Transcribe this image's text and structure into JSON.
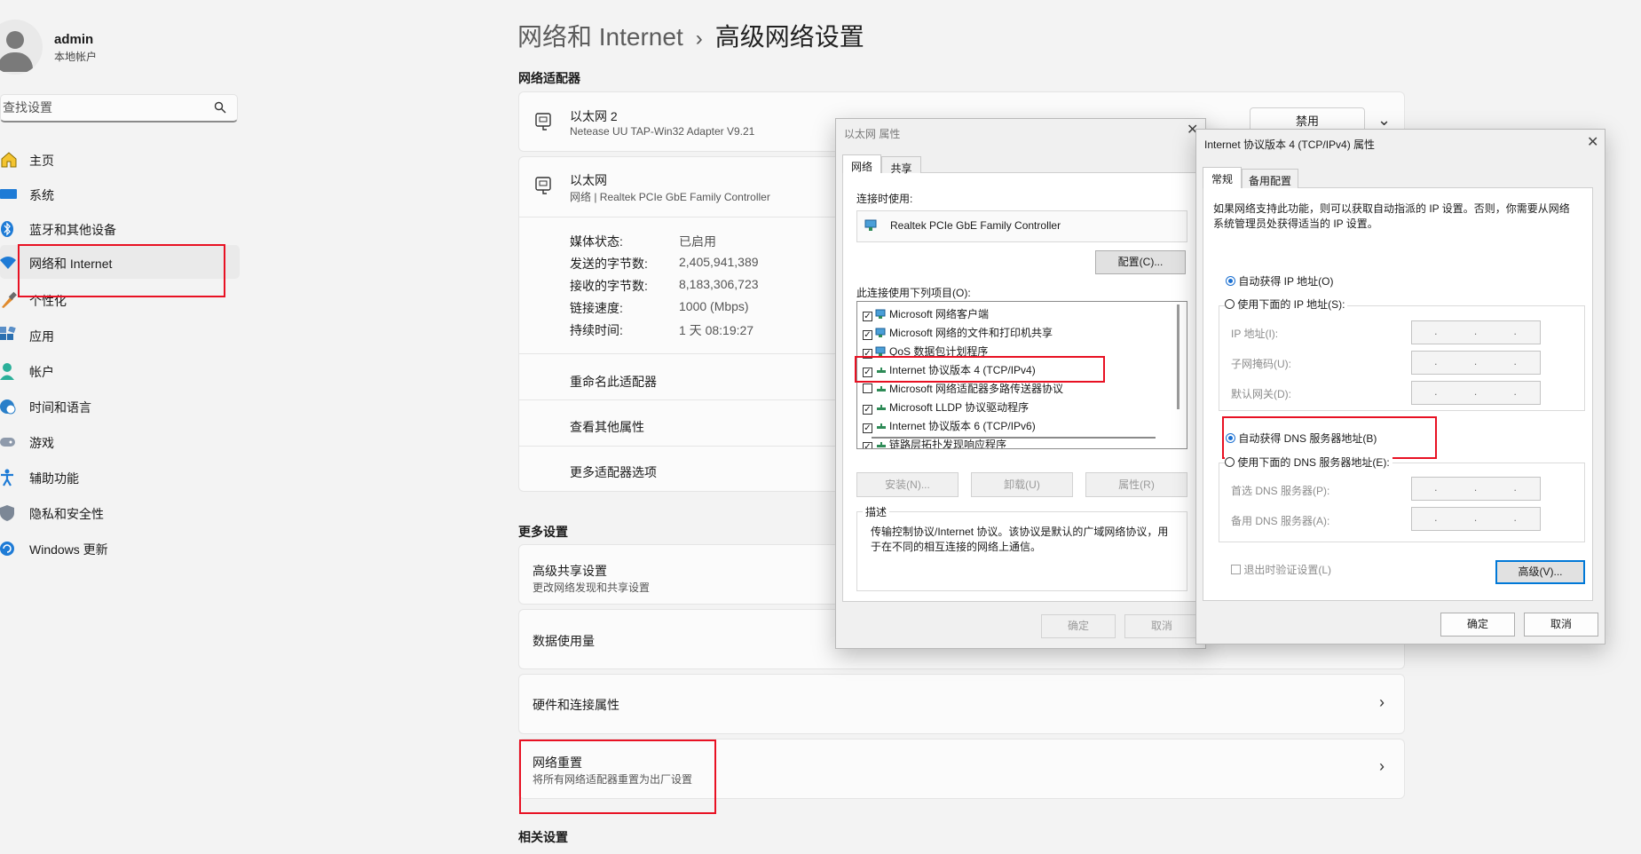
{
  "sidebar": {
    "user_name": "admin",
    "user_type": "本地帐户",
    "search_placeholder": "查找设置",
    "items": [
      {
        "label": "主页",
        "icon": "home-icon"
      },
      {
        "label": "系统",
        "icon": "system-icon"
      },
      {
        "label": "蓝牙和其他设备",
        "icon": "bluetooth-icon"
      },
      {
        "label": "网络和 Internet",
        "icon": "wifi-icon",
        "active": true
      },
      {
        "label": "个性化",
        "icon": "brush-icon"
      },
      {
        "label": "应用",
        "icon": "apps-icon"
      },
      {
        "label": "帐户",
        "icon": "account-icon"
      },
      {
        "label": "时间和语言",
        "icon": "globe-clock-icon"
      },
      {
        "label": "游戏",
        "icon": "gamepad-icon"
      },
      {
        "label": "辅助功能",
        "icon": "accessibility-icon"
      },
      {
        "label": "隐私和安全性",
        "icon": "shield-icon"
      },
      {
        "label": "Windows 更新",
        "icon": "update-icon"
      }
    ]
  },
  "header": {
    "parent": "网络和 Internet",
    "current": "高级网络设置"
  },
  "adapters": {
    "section_label": "网络适配器",
    "adapter1": {
      "name": "以太网 2",
      "desc": "Netease UU TAP-Win32 Adapter V9.21",
      "button": "禁用"
    },
    "adapter2": {
      "name": "以太网",
      "desc": "网络 | Realtek PCIe GbE Family Controller",
      "details": [
        {
          "key": "媒体状态:",
          "value": "已启用"
        },
        {
          "key": "发送的字节数:",
          "value": "2,405,941,389"
        },
        {
          "key": "接收的字节数:",
          "value": "8,183,306,723"
        },
        {
          "key": "链接速度:",
          "value": "1000 (Mbps)"
        },
        {
          "key": "持续时间:",
          "value": "1 天 08:19:27"
        }
      ],
      "actions": [
        "重命名此适配器",
        "查看其他属性",
        "更多适配器选项"
      ]
    }
  },
  "more": {
    "section_label": "更多设置",
    "items": [
      {
        "title": "高级共享设置",
        "sub": "更改网络发现和共享设置"
      },
      {
        "title": "数据使用量",
        "sub": ""
      },
      {
        "title": "硬件和连接属性",
        "sub": ""
      },
      {
        "title": "网络重置",
        "sub": "将所有网络适配器重置为出厂设置"
      }
    ],
    "related_label": "相关设置"
  },
  "ethernet_dialog": {
    "title": "以太网 属性",
    "tabs": [
      "网络",
      "共享"
    ],
    "connect_using_label": "连接时使用:",
    "adapter_name": "Realtek PCIe GbE Family Controller",
    "configure_button": "配置(C)...",
    "items_label": "此连接使用下列项目(O):",
    "items": [
      {
        "label": "Microsoft 网络客户端",
        "checked": true
      },
      {
        "label": "Microsoft 网络的文件和打印机共享",
        "checked": true
      },
      {
        "label": "QoS 数据包计划程序",
        "checked": true
      },
      {
        "label": "Internet 协议版本 4 (TCP/IPv4)",
        "checked": true
      },
      {
        "label": "Microsoft 网络适配器多路传送器协议",
        "checked": false
      },
      {
        "label": "Microsoft LLDP 协议驱动程序",
        "checked": true
      },
      {
        "label": "Internet 协议版本 6 (TCP/IPv6)",
        "checked": true
      },
      {
        "label": "链路层拓扑发现响应程序",
        "checked": true
      }
    ],
    "install_button": "安装(N)...",
    "uninstall_button": "卸载(U)",
    "properties_button": "属性(R)",
    "desc_label": "描述",
    "desc_text": "传输控制协议/Internet 协议。该协议是默认的广域网络协议，用于在不同的相互连接的网络上通信。",
    "ok_button": "确定",
    "cancel_button": "取消"
  },
  "ipv4_dialog": {
    "title": "Internet 协议版本 4 (TCP/IPv4) 属性",
    "tabs": [
      "常规",
      "备用配置"
    ],
    "intro": "如果网络支持此功能，则可以获取自动指派的 IP 设置。否则，你需要从网络系统管理员处获得适当的 IP 设置。",
    "auto_ip": "自动获得 IP 地址(O)",
    "manual_ip": "使用下面的 IP 地址(S):",
    "ip_label": "IP 地址(I):",
    "mask_label": "子网掩码(U):",
    "gateway_label": "默认网关(D):",
    "auto_dns": "自动获得 DNS 服务器地址(B)",
    "manual_dns": "使用下面的 DNS 服务器地址(E):",
    "pref_dns_label": "首选 DNS 服务器(P):",
    "alt_dns_label": "备用 DNS 服务器(A):",
    "ip_placeholder": ". . .",
    "validate_label": "退出时验证设置(L)",
    "advanced_button": "高级(V)...",
    "ok_button": "确定",
    "cancel_button": "取消",
    "close_glyph": "✕"
  },
  "colors": {
    "highlight": "#e81123",
    "accent": "#0067c0"
  }
}
